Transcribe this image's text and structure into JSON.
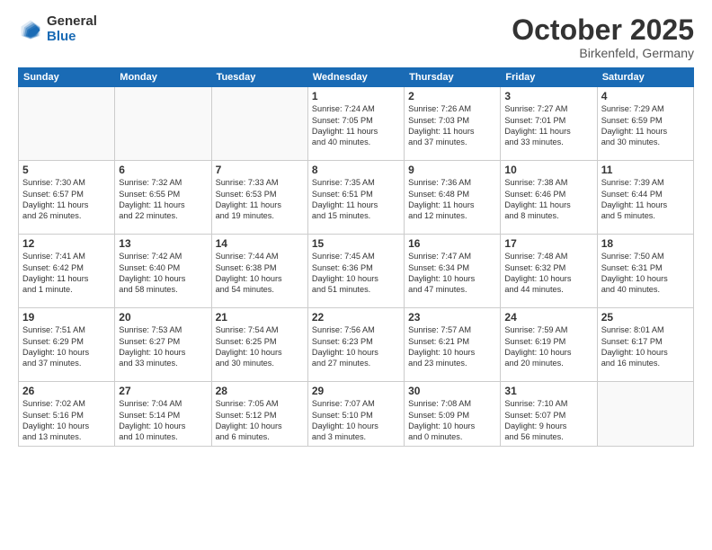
{
  "header": {
    "logo_general": "General",
    "logo_blue": "Blue",
    "month_title": "October 2025",
    "subtitle": "Birkenfeld, Germany"
  },
  "weekdays": [
    "Sunday",
    "Monday",
    "Tuesday",
    "Wednesday",
    "Thursday",
    "Friday",
    "Saturday"
  ],
  "weeks": [
    [
      {
        "day": "",
        "info": ""
      },
      {
        "day": "",
        "info": ""
      },
      {
        "day": "",
        "info": ""
      },
      {
        "day": "1",
        "info": "Sunrise: 7:24 AM\nSunset: 7:05 PM\nDaylight: 11 hours\nand 40 minutes."
      },
      {
        "day": "2",
        "info": "Sunrise: 7:26 AM\nSunset: 7:03 PM\nDaylight: 11 hours\nand 37 minutes."
      },
      {
        "day": "3",
        "info": "Sunrise: 7:27 AM\nSunset: 7:01 PM\nDaylight: 11 hours\nand 33 minutes."
      },
      {
        "day": "4",
        "info": "Sunrise: 7:29 AM\nSunset: 6:59 PM\nDaylight: 11 hours\nand 30 minutes."
      }
    ],
    [
      {
        "day": "5",
        "info": "Sunrise: 7:30 AM\nSunset: 6:57 PM\nDaylight: 11 hours\nand 26 minutes."
      },
      {
        "day": "6",
        "info": "Sunrise: 7:32 AM\nSunset: 6:55 PM\nDaylight: 11 hours\nand 22 minutes."
      },
      {
        "day": "7",
        "info": "Sunrise: 7:33 AM\nSunset: 6:53 PM\nDaylight: 11 hours\nand 19 minutes."
      },
      {
        "day": "8",
        "info": "Sunrise: 7:35 AM\nSunset: 6:51 PM\nDaylight: 11 hours\nand 15 minutes."
      },
      {
        "day": "9",
        "info": "Sunrise: 7:36 AM\nSunset: 6:48 PM\nDaylight: 11 hours\nand 12 minutes."
      },
      {
        "day": "10",
        "info": "Sunrise: 7:38 AM\nSunset: 6:46 PM\nDaylight: 11 hours\nand 8 minutes."
      },
      {
        "day": "11",
        "info": "Sunrise: 7:39 AM\nSunset: 6:44 PM\nDaylight: 11 hours\nand 5 minutes."
      }
    ],
    [
      {
        "day": "12",
        "info": "Sunrise: 7:41 AM\nSunset: 6:42 PM\nDaylight: 11 hours\nand 1 minute."
      },
      {
        "day": "13",
        "info": "Sunrise: 7:42 AM\nSunset: 6:40 PM\nDaylight: 10 hours\nand 58 minutes."
      },
      {
        "day": "14",
        "info": "Sunrise: 7:44 AM\nSunset: 6:38 PM\nDaylight: 10 hours\nand 54 minutes."
      },
      {
        "day": "15",
        "info": "Sunrise: 7:45 AM\nSunset: 6:36 PM\nDaylight: 10 hours\nand 51 minutes."
      },
      {
        "day": "16",
        "info": "Sunrise: 7:47 AM\nSunset: 6:34 PM\nDaylight: 10 hours\nand 47 minutes."
      },
      {
        "day": "17",
        "info": "Sunrise: 7:48 AM\nSunset: 6:32 PM\nDaylight: 10 hours\nand 44 minutes."
      },
      {
        "day": "18",
        "info": "Sunrise: 7:50 AM\nSunset: 6:31 PM\nDaylight: 10 hours\nand 40 minutes."
      }
    ],
    [
      {
        "day": "19",
        "info": "Sunrise: 7:51 AM\nSunset: 6:29 PM\nDaylight: 10 hours\nand 37 minutes."
      },
      {
        "day": "20",
        "info": "Sunrise: 7:53 AM\nSunset: 6:27 PM\nDaylight: 10 hours\nand 33 minutes."
      },
      {
        "day": "21",
        "info": "Sunrise: 7:54 AM\nSunset: 6:25 PM\nDaylight: 10 hours\nand 30 minutes."
      },
      {
        "day": "22",
        "info": "Sunrise: 7:56 AM\nSunset: 6:23 PM\nDaylight: 10 hours\nand 27 minutes."
      },
      {
        "day": "23",
        "info": "Sunrise: 7:57 AM\nSunset: 6:21 PM\nDaylight: 10 hours\nand 23 minutes."
      },
      {
        "day": "24",
        "info": "Sunrise: 7:59 AM\nSunset: 6:19 PM\nDaylight: 10 hours\nand 20 minutes."
      },
      {
        "day": "25",
        "info": "Sunrise: 8:01 AM\nSunset: 6:17 PM\nDaylight: 10 hours\nand 16 minutes."
      }
    ],
    [
      {
        "day": "26",
        "info": "Sunrise: 7:02 AM\nSunset: 5:16 PM\nDaylight: 10 hours\nand 13 minutes."
      },
      {
        "day": "27",
        "info": "Sunrise: 7:04 AM\nSunset: 5:14 PM\nDaylight: 10 hours\nand 10 minutes."
      },
      {
        "day": "28",
        "info": "Sunrise: 7:05 AM\nSunset: 5:12 PM\nDaylight: 10 hours\nand 6 minutes."
      },
      {
        "day": "29",
        "info": "Sunrise: 7:07 AM\nSunset: 5:10 PM\nDaylight: 10 hours\nand 3 minutes."
      },
      {
        "day": "30",
        "info": "Sunrise: 7:08 AM\nSunset: 5:09 PM\nDaylight: 10 hours\nand 0 minutes."
      },
      {
        "day": "31",
        "info": "Sunrise: 7:10 AM\nSunset: 5:07 PM\nDaylight: 9 hours\nand 56 minutes."
      },
      {
        "day": "",
        "info": ""
      }
    ]
  ]
}
